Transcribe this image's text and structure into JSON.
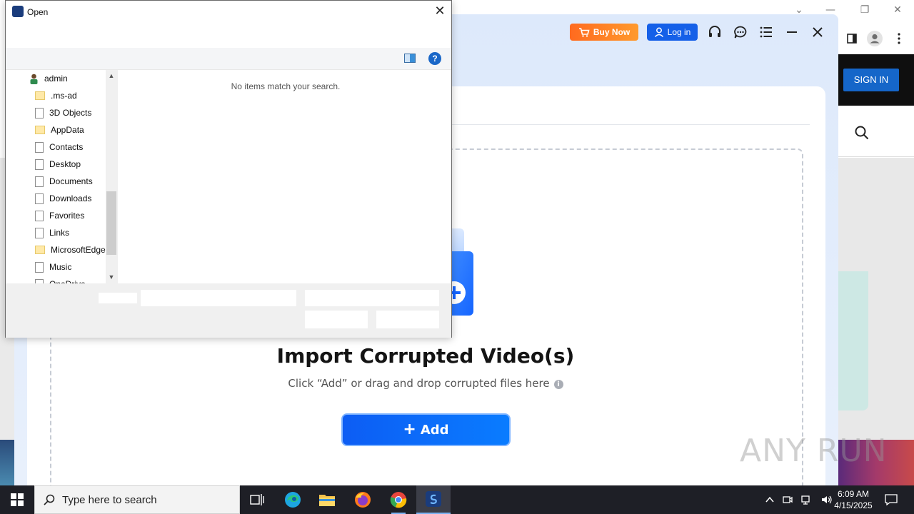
{
  "dialog": {
    "title": "Open",
    "close_glyph": "✕",
    "help_glyph": "?",
    "tree_items": [
      {
        "label": "admin",
        "icon": "user-icon"
      },
      {
        "label": ".ms-ad",
        "icon": "folder-icon"
      },
      {
        "label": "3D Objects",
        "icon": "page-icon"
      },
      {
        "label": "AppData",
        "icon": "folder-icon"
      },
      {
        "label": "Contacts",
        "icon": "page-icon"
      },
      {
        "label": "Desktop",
        "icon": "page-icon"
      },
      {
        "label": "Documents",
        "icon": "page-icon"
      },
      {
        "label": "Downloads",
        "icon": "page-icon"
      },
      {
        "label": "Favorites",
        "icon": "page-icon"
      },
      {
        "label": "Links",
        "icon": "page-icon"
      },
      {
        "label": "MicrosoftEdge",
        "icon": "folder-icon"
      },
      {
        "label": "Music",
        "icon": "page-icon"
      },
      {
        "label": "OneDrive",
        "icon": "page-icon"
      }
    ],
    "empty_message": "No items match your search.",
    "scroll_up": "▲",
    "scroll_down": "▼"
  },
  "app": {
    "buy_now_label": "Buy Now",
    "login_label": "Log in",
    "import_title": "Import Corrupted Video(s)",
    "import_subtitle": "Click “Add” or drag and drop corrupted files here",
    "info_glyph": "i",
    "add_label": "Add",
    "add_glyph": "+"
  },
  "browser": {
    "signin_label": "SIGN IN",
    "chevron_glyph": "⌄",
    "minimize_glyph": "—",
    "restore_glyph": "❐",
    "close_glyph": "✕"
  },
  "watermark": "ANY RUN",
  "taskbar": {
    "search_placeholder": "Type here to search",
    "time": "6:09 AM",
    "date": "4/15/2025"
  },
  "colors": {
    "accent": "#0d5df4",
    "buy_now": "#ff7a22",
    "taskbar": "#1e1f26"
  }
}
